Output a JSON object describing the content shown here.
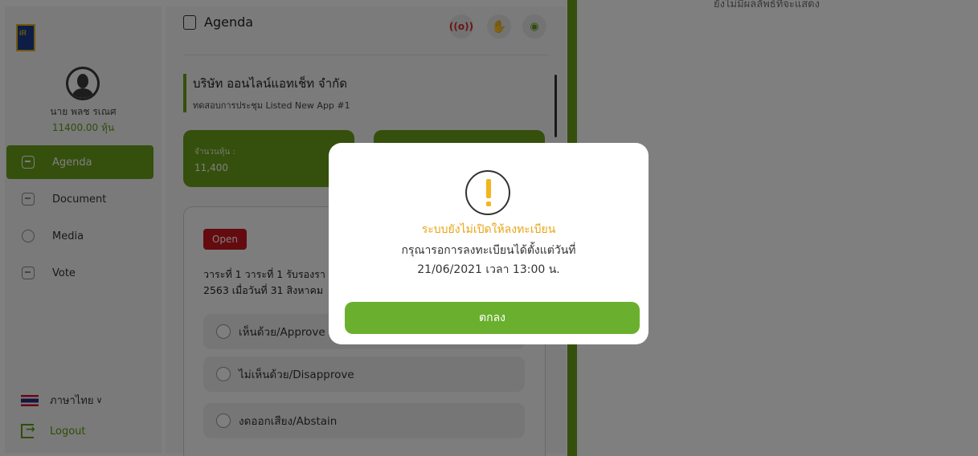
{
  "sidebar": {
    "logo_text": "iR",
    "user_name": "นาย พลช รเณศ",
    "user_shares": "11400.00 หุ้น",
    "items": [
      {
        "label": "Agenda",
        "icon": "agenda-icon",
        "active": true
      },
      {
        "label": "Document",
        "icon": "document-icon",
        "active": false
      },
      {
        "label": "Media",
        "icon": "media-icon",
        "active": false
      },
      {
        "label": "Vote",
        "icon": "vote-icon",
        "active": false
      }
    ],
    "language": "ภาษาไทย",
    "logout": "Logout"
  },
  "agenda": {
    "title": "Agenda",
    "live_label": "LIVE",
    "company_name": "บริษัท ออนไลน์แอทเช็ท จำกัด",
    "meeting_name": "ทดสอบการประชุม Listed New App #1",
    "stat_label": "จำนวนหุ้น :",
    "stat_value": "11,400",
    "open_badge": "Open",
    "vote_title_line1": "วาระที่ 1 วาระที่ 1 รับรองรา",
    "vote_title_line2": "2563 เมื่อวันที่ 31 สิงหาคม",
    "options": [
      {
        "label": "เห็นด้วย/Approve"
      },
      {
        "label": "ไม่เห็นด้วย/Disapprove"
      },
      {
        "label": "งดออกเสียง/Abstain"
      }
    ]
  },
  "results": {
    "empty_text": "ยังไม่มีผลลัพธ์ที่จะแสดง"
  },
  "modal": {
    "title": "ระบบยังไม่เปิดให้ลงทะเบียน",
    "line1": "กรุณารอการลงทะเบียนได้ตั้งแต่วันที่",
    "line2": "21/06/2021 เวลา 13:00 น.",
    "ok_label": "ตกลง"
  },
  "colors": {
    "brand_green": "#6a9f1b",
    "button_green": "#6ab02e",
    "warning_yellow": "#f3b51b",
    "open_red": "#c8171f"
  }
}
